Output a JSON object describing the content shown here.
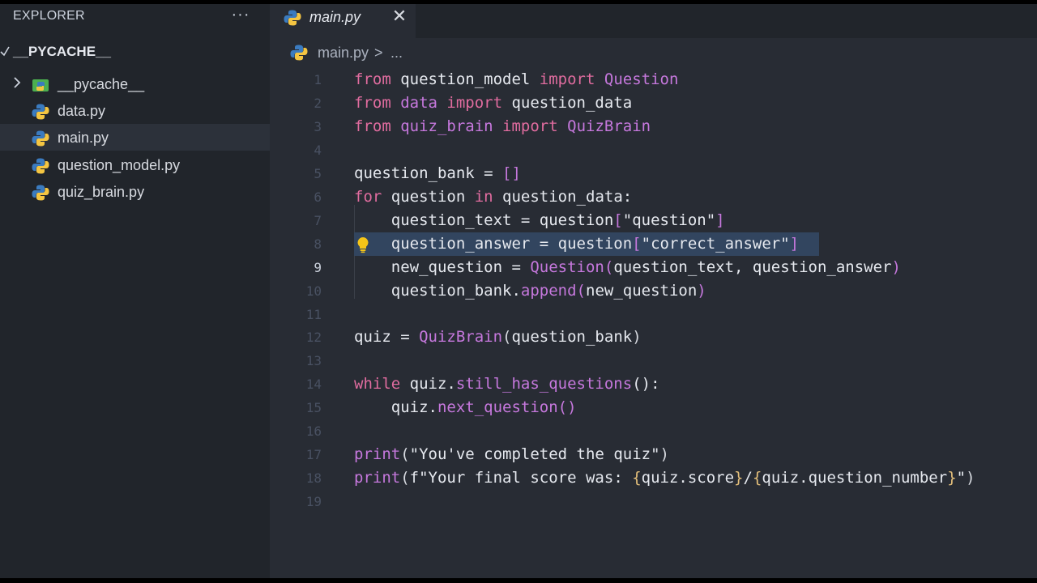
{
  "sidebar": {
    "title": "EXPLORER",
    "more": "···",
    "folder": {
      "chevron": "✓",
      "name": "__PYCACHE__"
    },
    "items": [
      {
        "label": "__pycache__",
        "icon": "python-folder-icon"
      },
      {
        "label": "data.py",
        "icon": "python-file-icon"
      },
      {
        "label": "main.py",
        "icon": "python-file-icon",
        "selected": true
      },
      {
        "label": "question_model.py",
        "icon": "python-file-icon"
      },
      {
        "label": "quiz_brain.py",
        "icon": "python-file-icon"
      }
    ]
  },
  "tab": {
    "label": "main.py",
    "close": "✕"
  },
  "breadcrumb": {
    "file": "main.py",
    "separator": ">",
    "more": "..."
  },
  "editor": {
    "active_line": 9,
    "lines": [
      {
        "n": "1"
      },
      {
        "n": "2"
      },
      {
        "n": "3"
      },
      {
        "n": "4"
      },
      {
        "n": "5"
      },
      {
        "n": "6"
      },
      {
        "n": "7"
      },
      {
        "n": "8"
      },
      {
        "n": "9"
      },
      {
        "n": "10"
      },
      {
        "n": "11"
      },
      {
        "n": "12"
      },
      {
        "n": "13"
      },
      {
        "n": "14"
      },
      {
        "n": "15"
      },
      {
        "n": "16"
      },
      {
        "n": "17"
      },
      {
        "n": "18"
      },
      {
        "n": "19"
      }
    ],
    "tokens": {
      "l1": [
        "from",
        " question_model ",
        "import",
        " Question"
      ],
      "l2": [
        "from",
        " data ",
        "import",
        " question_data"
      ],
      "l3": [
        "from",
        " quiz_brain ",
        "import",
        " QuizBrain"
      ],
      "l5": [
        "question_bank = ",
        "[]"
      ],
      "l6": [
        "for",
        " question ",
        "in",
        " question_data:"
      ],
      "l7": [
        "    question_text = question",
        "[",
        "\"question\"",
        "]"
      ],
      "l8": [
        "    question_answer = question",
        "[",
        "\"correct_answer\"",
        "]"
      ],
      "l9": [
        "    new_question = ",
        "Question",
        "(",
        "question_text, question_answer",
        ")"
      ],
      "l10": [
        "    question_bank.",
        "append",
        "(",
        "new_question",
        ")"
      ],
      "l12": [
        "quiz = ",
        "QuizBrain",
        "(",
        "question_bank",
        ")"
      ],
      "l14": [
        "while",
        " quiz.",
        "still_has_questions",
        "():"
      ],
      "l15": [
        "    quiz.",
        "next_question",
        "()"
      ],
      "l17": [
        "print",
        "(",
        "\"You've completed the quiz\"",
        ")"
      ],
      "l18": [
        "print",
        "(",
        "f\"Your final score was: ",
        "{",
        "quiz.score",
        "}",
        "/",
        "{",
        "quiz.question_number",
        "}",
        "\"",
        ")"
      ]
    }
  },
  "colors": {
    "keyword": "#e06c9f",
    "function": "#c678dd",
    "brace": "#e5c07b",
    "selection": "#32455f"
  }
}
